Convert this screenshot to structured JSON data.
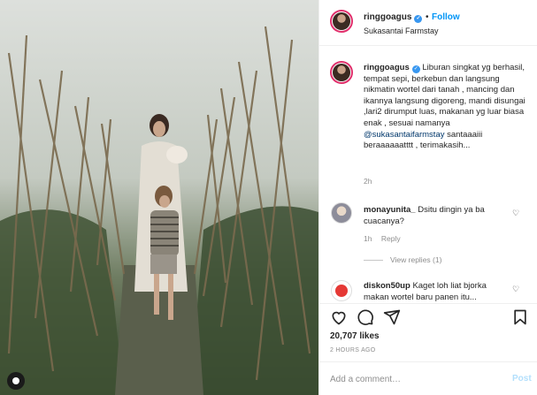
{
  "header": {
    "username": "ringgoagus",
    "follow_label": "Follow",
    "separator": "•",
    "location": "Sukasantai Farmstay"
  },
  "caption": {
    "username": "ringgoagus",
    "text_before_mention": "Liburan singkat yg berhasil, tempat sepi, berkebun dan langsung nikmatin wortel dari tanah , mancing dan ikannya langsung digoreng, mandi disungai ,lari2 dirumput luas, makanan yg luar biasa enak , sesuai namanya",
    "mention": "@sukasantaifarmstay",
    "text_after_mention": "santaaaiii beraaaaaatttt , terimakasih...",
    "time": "2h"
  },
  "comments": [
    {
      "username": "monayunita_",
      "text": "Dsitu dingin ya ba cuacanya?",
      "time": "1h",
      "reply_label": "Reply",
      "view_replies": "View replies (1)"
    },
    {
      "username": "diskon50up",
      "text": "Kaget loh liat bjorka makan wortel baru panen itu..."
    }
  ],
  "actions": {
    "likes": "20,707 likes",
    "time_ago": "2 HOURS AGO"
  },
  "add_comment": {
    "placeholder": "Add a comment…",
    "post_label": "Post"
  },
  "icons": {
    "like": "heart-icon",
    "comment": "comment-icon",
    "share": "share-icon",
    "save": "bookmark-icon",
    "verified": "verified-badge-icon",
    "tags": "user-tag-icon"
  },
  "colors": {
    "accent": "#0095f6",
    "verified": "#3897f0",
    "post_disabled": "#b2dffc",
    "muted": "#8e8e8e"
  }
}
